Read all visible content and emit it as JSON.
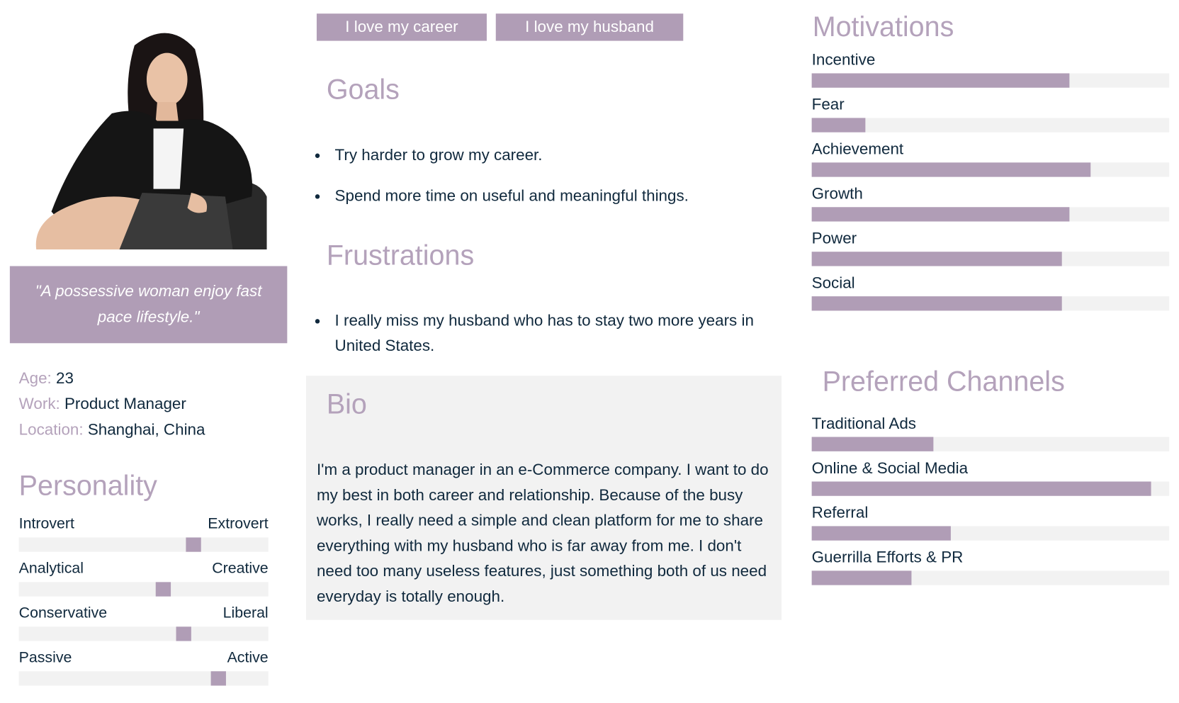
{
  "profile": {
    "quote": "\"A possessive woman enjoy fast pace lifestyle.\"",
    "age_label": "Age:",
    "age": "23",
    "work_label": "Work:",
    "work": "Product Manager",
    "location_label": "Location:",
    "location": "Shanghai, China"
  },
  "personality": {
    "title": "Personality",
    "traits": [
      {
        "left": "Introvert",
        "right": "Extrovert",
        "value": 0.7
      },
      {
        "left": "Analytical",
        "right": "Creative",
        "value": 0.58
      },
      {
        "left": "Conservative",
        "right": "Liberal",
        "value": 0.66
      },
      {
        "left": "Passive",
        "right": "Active",
        "value": 0.8
      }
    ]
  },
  "tags": [
    "I love my career",
    "I love my husband"
  ],
  "goals": {
    "title": "Goals",
    "items": [
      "Try harder to grow my career.",
      "Spend more time on useful and meaningful things."
    ]
  },
  "frustrations": {
    "title": "Frustrations",
    "items": [
      "I really miss my husband who has to stay two more years in United States."
    ]
  },
  "bio": {
    "title": "Bio",
    "text": "I'm a product manager in an e-Commerce company. I want to do my best in both career and relationship. Because of the busy works, I really need a simple and clean platform for me to share everything with my husband who is far away from me. I don't need too many useless features, just something both of us need everyday is totally enough."
  },
  "motivations": {
    "title": "Motivations",
    "items": [
      {
        "label": "Incentive",
        "value": 72
      },
      {
        "label": "Fear",
        "value": 15
      },
      {
        "label": "Achievement",
        "value": 78
      },
      {
        "label": "Growth",
        "value": 72
      },
      {
        "label": "Power",
        "value": 70
      },
      {
        "label": "Social",
        "value": 70
      }
    ]
  },
  "channels": {
    "title": "Preferred Channels",
    "items": [
      {
        "label": "Traditional Ads",
        "value": 34
      },
      {
        "label": "Online & Social Media",
        "value": 95
      },
      {
        "label": "Referral",
        "value": 39
      },
      {
        "label": "Guerrilla Efforts & PR",
        "value": 28
      }
    ]
  }
}
